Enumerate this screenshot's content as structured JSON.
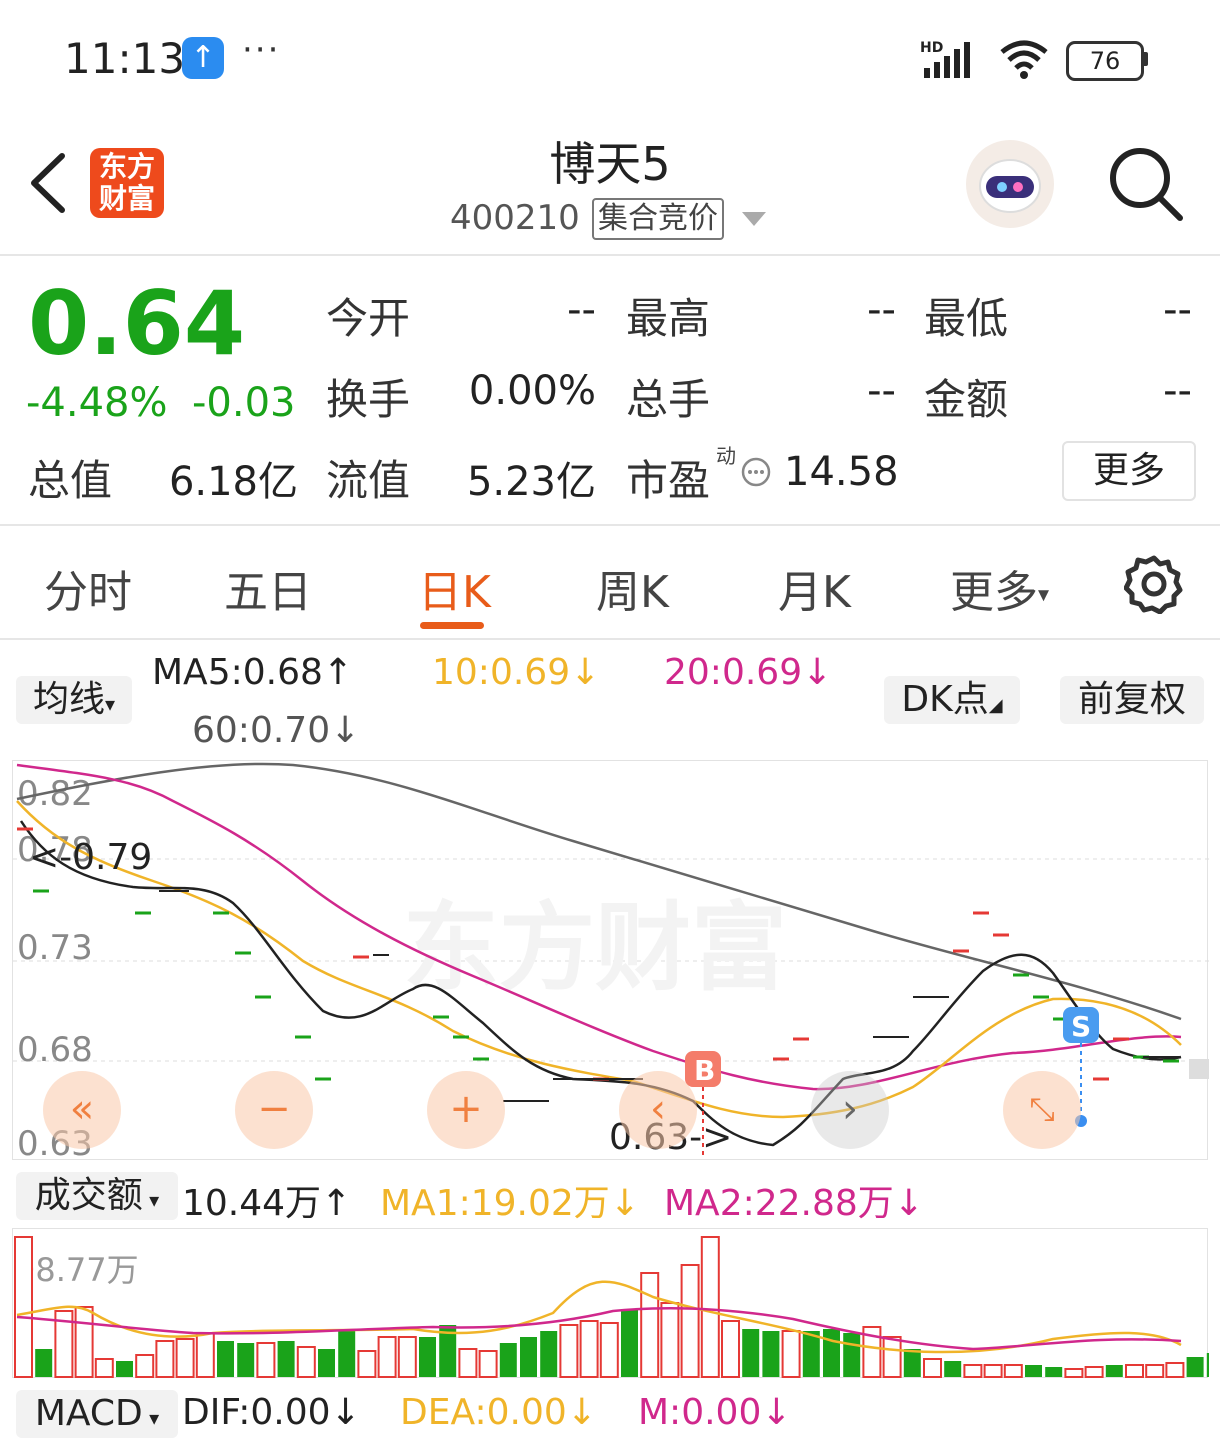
{
  "status_bar": {
    "time": "11:13",
    "battery": "76",
    "network": "HD"
  },
  "header": {
    "title": "博天5",
    "code": "400210",
    "auction_tag": "集合竞价"
  },
  "quote": {
    "price": "0.64",
    "change_pct": "-4.48%",
    "change": "-0.03",
    "fields": [
      {
        "label": "今开",
        "value": "--"
      },
      {
        "label": "最高",
        "value": "--"
      },
      {
        "label": "最低",
        "value": "--"
      },
      {
        "label": "换手",
        "value": "0.00%"
      },
      {
        "label": "总手",
        "value": "--"
      },
      {
        "label": "金额",
        "value": "--"
      },
      {
        "label": "总值",
        "value": "6.18亿"
      },
      {
        "label": "流值",
        "value": "5.23亿"
      },
      {
        "label": "市盈",
        "value": "14.58"
      }
    ],
    "pe_sup": "动",
    "more": "更多"
  },
  "tabs": [
    "分时",
    "五日",
    "日K",
    "周K",
    "月K",
    "更多"
  ],
  "ma_bar": {
    "selector": "均线",
    "ma5": "MA5:0.68",
    "ma10": "10:0.69",
    "ma20": "20:0.69",
    "ma60": "60:0.70",
    "dk": "DK点",
    "adjust": "前复权"
  },
  "kline": {
    "y_labels": [
      "0.82",
      "0.78",
      "0.73",
      "0.68",
      "0.63"
    ],
    "max_label": "<-0.79",
    "min_label": "0.63->",
    "buy_marker": "B",
    "sell_marker": "S",
    "colors": {
      "ma5": "#222222",
      "ma10": "#f0b429",
      "ma20": "#d0288c",
      "ma60": "#666666",
      "up": "#e53935",
      "down": "#1aa31a"
    }
  },
  "volume": {
    "selector": "成交额",
    "value": "10.44万",
    "ma1": "MA1:19.02万",
    "ma2": "MA2:22.88万",
    "max_label": "98.77万"
  },
  "macd": {
    "selector": "MACD",
    "dif": "DIF:0.00",
    "dea": "DEA:0.00",
    "m": "M:0.00"
  },
  "colors": {
    "accent": "#e85c1a",
    "down": "#1aa31a",
    "up": "#e53935",
    "ma10": "#f0b429",
    "ma20": "#d0288c"
  },
  "icons": [
    "back-arrow-icon",
    "search-icon",
    "settings-gear-icon",
    "upload-arrow-icon",
    "signal-icon",
    "wifi-icon"
  ]
}
